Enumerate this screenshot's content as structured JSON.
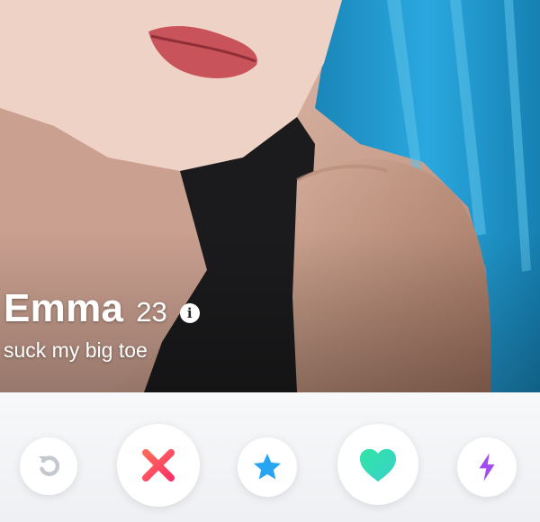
{
  "profile": {
    "name": "Emma",
    "age": "23",
    "bio": "suck my big toe",
    "info_icon": "info-icon"
  },
  "actions": [
    {
      "name": "rewind",
      "icon": "rewind-icon",
      "color": "#c4c8cf"
    },
    {
      "name": "nope",
      "icon": "close-icon",
      "color": "#ff4458"
    },
    {
      "name": "super-like",
      "icon": "star-icon",
      "color": "#27a4f2"
    },
    {
      "name": "like",
      "icon": "heart-icon",
      "color": "#34e2b5"
    },
    {
      "name": "boost",
      "icon": "lightning-icon",
      "color": "#a14bf0"
    }
  ]
}
